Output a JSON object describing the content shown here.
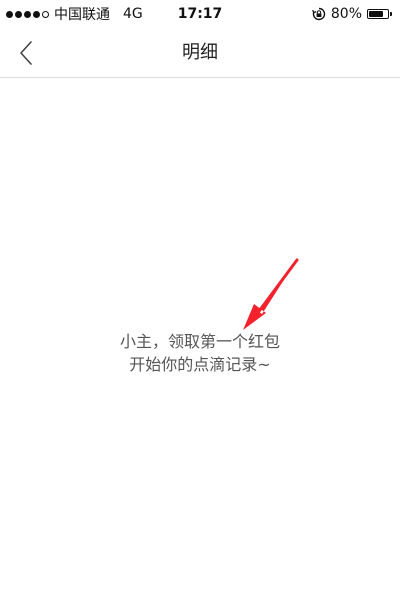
{
  "status_bar": {
    "signal_strength": 4,
    "signal_total": 5,
    "carrier": "中国联通",
    "network": "4G",
    "time": "17:17",
    "battery_percent_label": "80%",
    "battery_level": 0.8
  },
  "nav": {
    "back_icon": "chevron-left-icon",
    "title": "明细"
  },
  "empty_state": {
    "line1": "小主，领取第一个红包",
    "line2": "开始你的点滴记录~"
  },
  "annotation": {
    "arrow_color": "#f5222d"
  }
}
